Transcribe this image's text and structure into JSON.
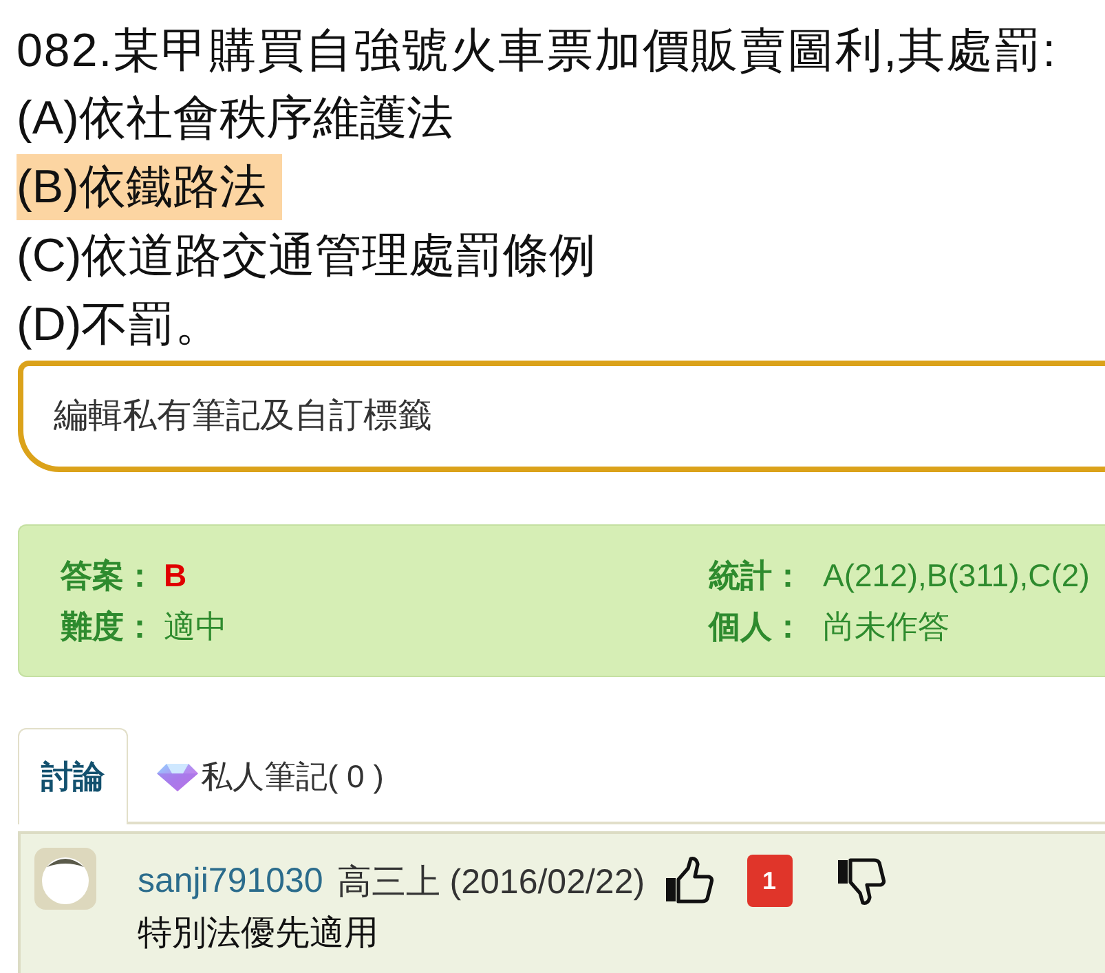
{
  "question": {
    "text": "082.某甲購買自強號火車票加價販賣圖利,其處罰:"
  },
  "options": [
    {
      "text": "(A)依社會秩序維護法",
      "selected": false
    },
    {
      "text": "(B)依鐵路法",
      "selected": true
    },
    {
      "text": "(C)依道路交通管理處罰條例",
      "selected": false
    },
    {
      "text": "(D)不罰。",
      "selected": false
    }
  ],
  "note_field": {
    "placeholder": "編輯私有筆記及自訂標籤"
  },
  "answer_panel": {
    "columns": [
      {
        "items": [
          {
            "label": "答案：",
            "value": "B",
            "kind": "answer"
          },
          {
            "label": "難度：",
            "value": "適中",
            "kind": "plain"
          }
        ]
      },
      {
        "items": [
          {
            "label": "統計：",
            "value": "A(212),B(311),C(2)",
            "kind": "plain"
          },
          {
            "label": "個人：",
            "value": "尚未作答",
            "kind": "plain"
          }
        ]
      }
    ]
  },
  "tabs": [
    {
      "label": "討論",
      "kind": "discussion",
      "selected": true
    },
    {
      "label": "私人筆記( 0 )",
      "kind": "notes",
      "selected": false
    }
  ],
  "comments": [
    {
      "user": "sanji791030",
      "meta": "高三上 (2016/02/22)",
      "likes": "1",
      "text": "特別法優先適用"
    }
  ]
}
